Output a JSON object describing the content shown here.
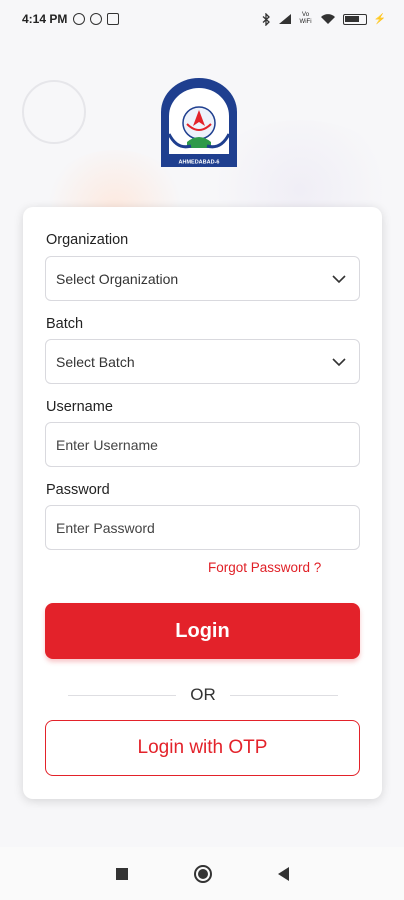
{
  "status_bar": {
    "time": "4:14 PM",
    "network_label": "Vo WiFi"
  },
  "logo": {
    "icon": "institution-emblem-icon",
    "caption": "AHMEDABAD-6"
  },
  "form": {
    "organization": {
      "label": "Organization",
      "selected": "Select Organization"
    },
    "batch": {
      "label": "Batch",
      "selected": "Select Batch"
    },
    "username": {
      "label": "Username",
      "placeholder": "Enter Username",
      "value": ""
    },
    "password": {
      "label": "Password",
      "placeholder": "Enter Password",
      "value": ""
    },
    "forgot_password": "Forgot Password ?",
    "login_label": "Login",
    "or_label": "OR",
    "otp_label": "Login with OTP"
  },
  "colors": {
    "accent": "#e3222a",
    "background": "#f7f7f9",
    "card": "#ffffff"
  }
}
